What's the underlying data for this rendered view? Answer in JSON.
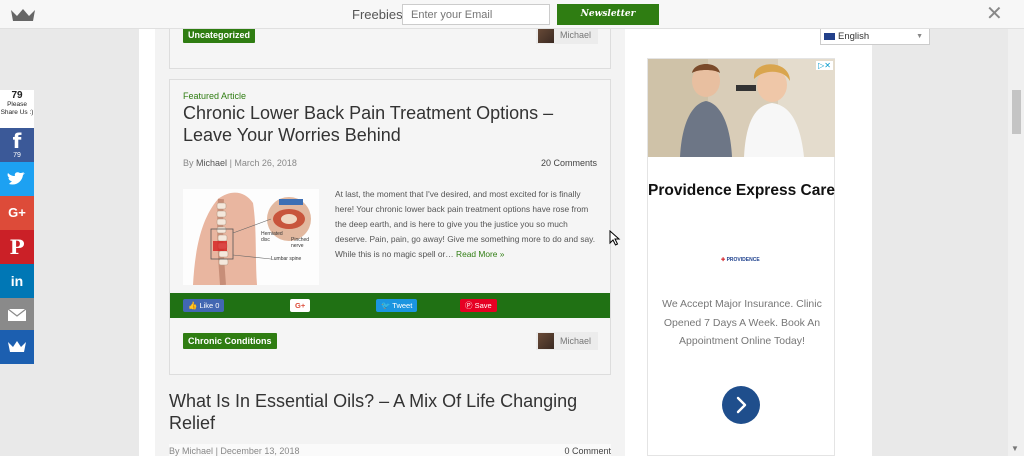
{
  "topbar": {
    "freebies_label": "Freebies",
    "email_placeholder": "Enter your Email",
    "newsletter_label": "Newsletter",
    "close_glyph": "✕"
  },
  "prev_post": {
    "category": "Uncategorized",
    "author": "Michael"
  },
  "featured_post": {
    "eyebrow": "Featured Article",
    "title": "Chronic Lower Back Pain Treatment Options – Leave Your Worries Behind",
    "byline_prefix": "By",
    "author": "Michael",
    "date": "| March 26, 2018",
    "comments": "20 Comments",
    "excerpt": "At last, the moment that I've desired, and most excited for is finally here! Your chronic lower back pain treatment options have rose from the deep earth, and is here to give you the justice you so much deserve. Pain, pain, go away! Give me something more to do and say. While this is no magic spell or…",
    "read_more": "Read More »",
    "image_labels": {
      "herniated": "Herniated disc",
      "pinched": "Pinched nerve",
      "lumbar": "Lumbar spine"
    },
    "share_buttons": {
      "like": "Like 0",
      "gplus": "G+",
      "tweet": "Tweet",
      "save": "Save"
    },
    "category": "Chronic Conditions"
  },
  "next_post": {
    "title": "What Is In Essential Oils? – A Mix Of Life Changing Relief",
    "byline_prefix": "By",
    "author": "Michael",
    "date": "| December 13, 2018",
    "comments": "0 Comment"
  },
  "language": {
    "selected": "English",
    "caret": "▼"
  },
  "ad": {
    "adchoices": "▷✕",
    "title": "Providence Express Care",
    "logo_text": "PROVIDENCE",
    "body": "We Accept Major Insurance. Clinic Opened 7 Days A Week. Book An Appointment Online Today!"
  },
  "social": {
    "share_count": "79",
    "share_label": "Please Share Us :)",
    "facebook_count": "79",
    "colors": {
      "facebook": "#3b5998",
      "twitter": "#1da1f2",
      "google": "#dd4b39",
      "pinterest": "#cb2027",
      "linkedin": "#0077b5",
      "email": "#8a8a8a",
      "crown": "#1c5fb0"
    }
  },
  "colors": {
    "accent_green": "#2f7d12",
    "share_bar_green": "#207114"
  }
}
